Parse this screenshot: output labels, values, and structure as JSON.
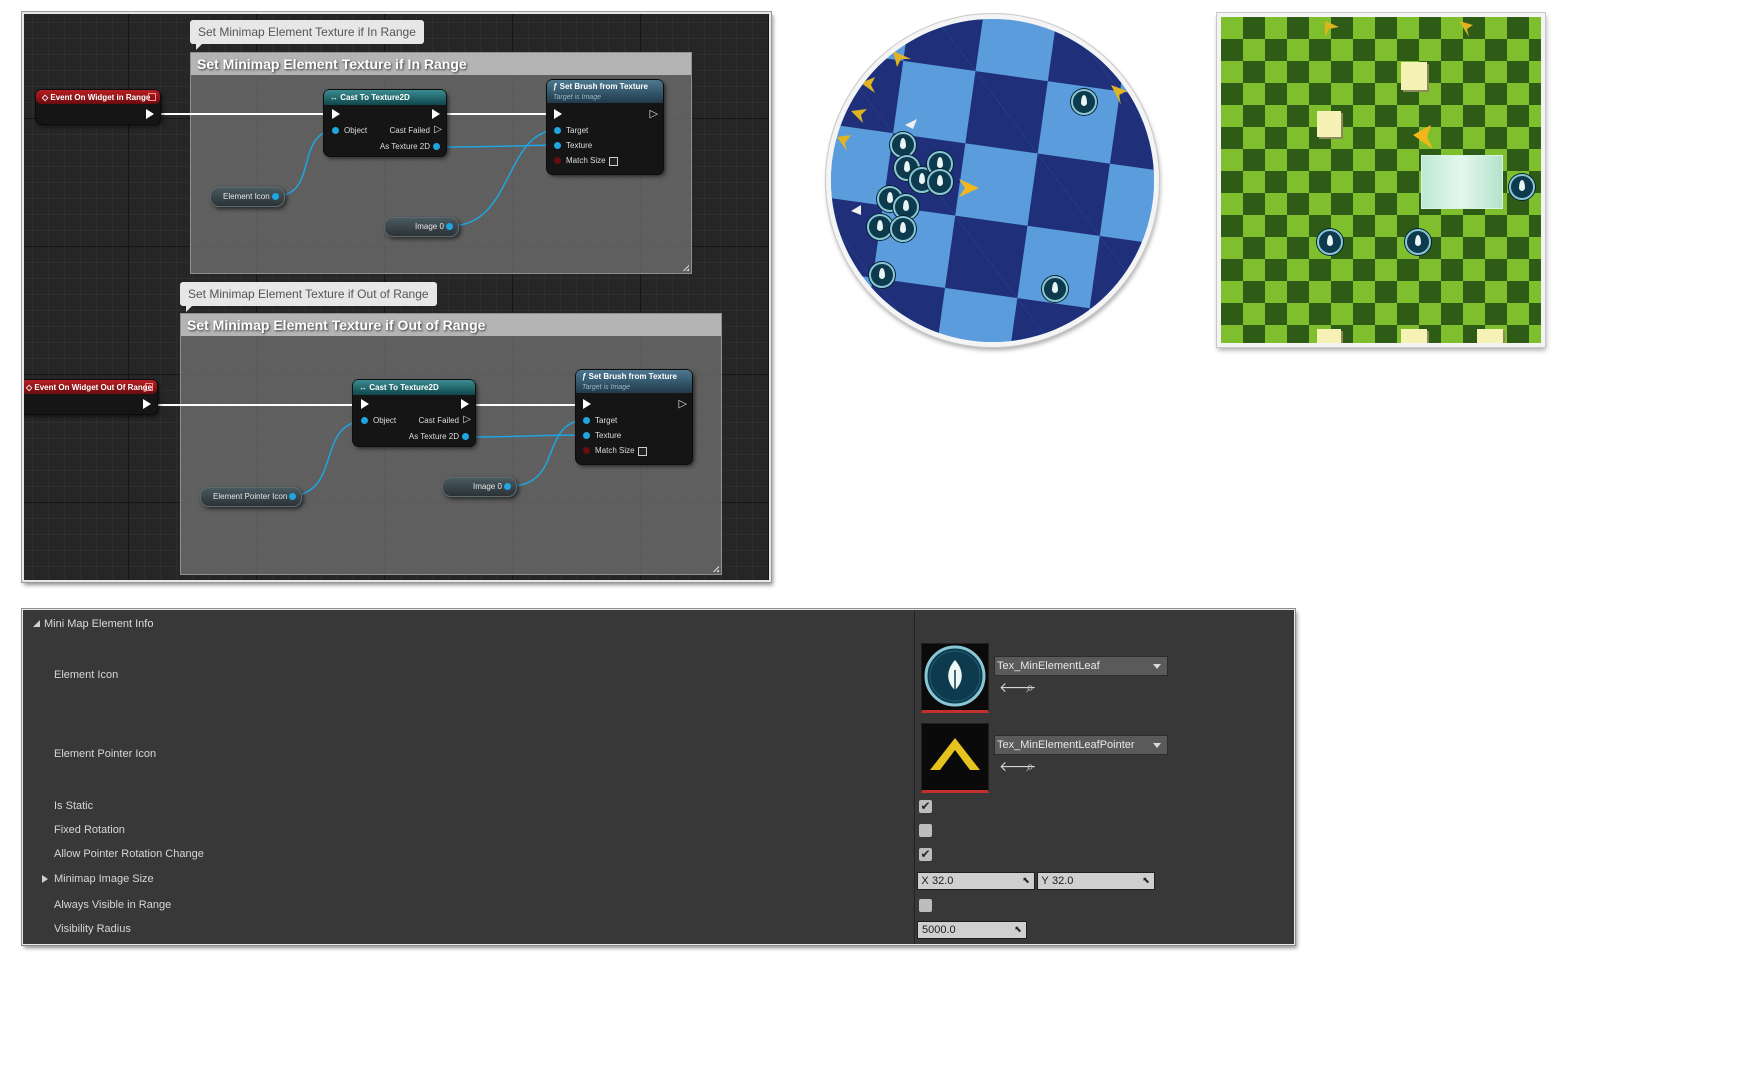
{
  "blueprint": {
    "in_range": {
      "comment_bubble": "Set Minimap Element Texture if In Range",
      "comment_title": "Set Minimap Element Texture if In Range",
      "event_node": "Event On Widget in Range",
      "cast_node": "Cast To Texture2D",
      "cast_pins": {
        "object": "Object",
        "cast_failed": "Cast Failed",
        "as_texture": "As Texture 2D"
      },
      "func_node": "Set Brush from Texture",
      "func_sub": "Target is Image",
      "func_pins": {
        "target": "Target",
        "texture": "Texture",
        "match_size": "Match Size"
      },
      "var_icon": "Element Icon",
      "var_image": "Image 0"
    },
    "out_range": {
      "comment_bubble": "Set Minimap Element Texture if Out of Range",
      "comment_title": "Set Minimap Element Texture if Out of Range",
      "event_node": "Event On Widget Out Of Range",
      "cast_node": "Cast To Texture2D",
      "cast_pins": {
        "object": "Object",
        "cast_failed": "Cast Failed",
        "as_texture": "As Texture 2D"
      },
      "func_node": "Set Brush from Texture",
      "func_sub": "Target is Image",
      "func_pins": {
        "target": "Target",
        "texture": "Texture",
        "match_size": "Match Size"
      },
      "var_icon": "Element Pointer Icon",
      "var_image": "Image 0"
    }
  },
  "minimaps": {
    "circle_colors": {
      "light": "#5b9ddc",
      "dark": "#1f2f7a"
    },
    "square_colors": {
      "light": "#7fbf2e",
      "dark": "#2e5c17"
    },
    "marker_icon": "leaf-marker-icon",
    "pointer_icon": "chevron-pointer-icon"
  },
  "details": {
    "section": "Mini Map Element Info",
    "properties": {
      "element_icon": {
        "label": "Element Icon",
        "value": "Tex_MinElementLeaf"
      },
      "element_pointer_icon": {
        "label": "Element Pointer Icon",
        "value": "Tex_MinElementLeafPointer"
      },
      "is_static": {
        "label": "Is Static",
        "checked": true,
        "mark": "✔"
      },
      "fixed_rotation": {
        "label": "Fixed Rotation",
        "checked": false
      },
      "allow_pointer_rotation": {
        "label": "Allow Pointer Rotation Change",
        "checked": true,
        "mark": "✔"
      },
      "minimap_image_size": {
        "label": "Minimap Image Size",
        "x_label": "X",
        "x": "32.0",
        "y_label": "Y",
        "y": "32.0"
      },
      "always_visible": {
        "label": "Always Visible in Range",
        "checked": false
      },
      "visibility_radius": {
        "label": "Visibility Radius",
        "value": "5000.0"
      }
    },
    "accent_red": "#c43030"
  }
}
